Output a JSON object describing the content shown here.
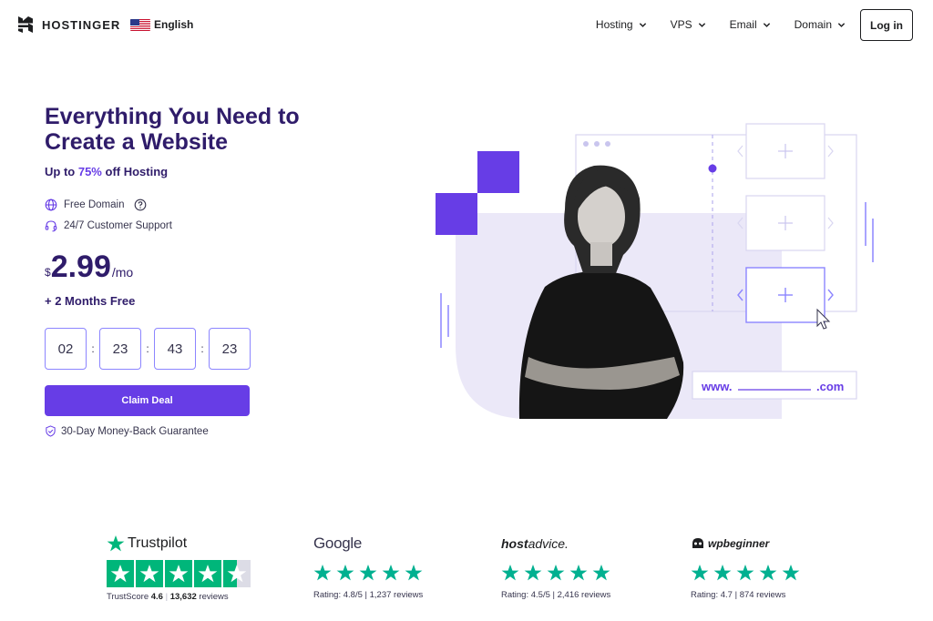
{
  "header": {
    "brand": "HOSTINGER",
    "language": "English",
    "nav": [
      {
        "label": "Hosting"
      },
      {
        "label": "VPS"
      },
      {
        "label": "Email"
      },
      {
        "label": "Domain"
      }
    ],
    "login_label": "Log in"
  },
  "hero": {
    "title": "Everything You Need to Create a Website",
    "subline_prefix": "Up to",
    "subline_pct": "75%",
    "subline_suffix": "off Hosting",
    "features": [
      {
        "label": "Free Domain",
        "icon": "globe-icon"
      },
      {
        "label": "24/7 Customer Support",
        "icon": "headset-icon"
      }
    ],
    "price": {
      "currency": "$",
      "amount": "2.99",
      "period": "/mo"
    },
    "bonus": "+ 2 Months Free",
    "timer": [
      "02",
      "23",
      "43",
      "23"
    ],
    "timer_separator": ":",
    "cta_label": "Claim Deal",
    "guarantee": "30-Day Money-Back Guarantee",
    "illustration": {
      "url_prefix": "www.",
      "url_suffix": ".com"
    }
  },
  "ratings": {
    "trustpilot": {
      "brand": "Trustpilot",
      "score_label": "TrustScore",
      "score": "4.6",
      "reviews_count": "13,632",
      "reviews_label": "reviews"
    },
    "google": {
      "brand": "Google",
      "text": "Rating: 4.8/5 | 1,237 reviews"
    },
    "hostadvice": {
      "brand_bold": "host",
      "brand_rest": "advice.",
      "text": "Rating: 4.5/5 | 2,416 reviews"
    },
    "wpbeginner": {
      "brand": "wpbeginner",
      "text": "Rating: 4.7 | 874 reviews"
    }
  },
  "colors": {
    "accent": "#673de6",
    "heading": "#2f1c6a",
    "rating_green": "#00b67a",
    "star_green": "#00b090"
  }
}
